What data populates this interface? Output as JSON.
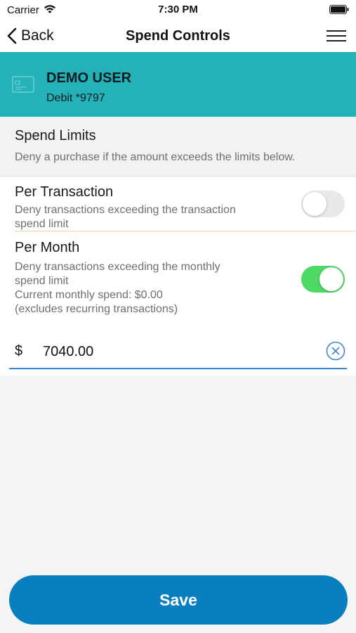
{
  "status_bar": {
    "carrier": "Carrier",
    "time": "7:30 PM"
  },
  "nav": {
    "back_label": "Back",
    "title": "Spend Controls"
  },
  "card": {
    "name": "DEMO USER",
    "number": "Debit *9797",
    "banner_color": "#24b1b7"
  },
  "spend_limits": {
    "title": "Spend Limits",
    "description": "Deny a purchase if the amount exceeds the limits below."
  },
  "per_transaction": {
    "title": "Per Transaction",
    "desc_line1": "Deny transactions exceeding the transaction",
    "desc_line2": "spend limit",
    "enabled": false
  },
  "per_month": {
    "title": "Per Month",
    "desc_line1": "Deny transactions exceeding the monthly",
    "desc_line2": "spend limit",
    "desc_line3": "Current monthly spend: $0.00",
    "desc_line4": "(excludes recurring transactions)",
    "enabled": true,
    "currency": "$",
    "amount": "7040.00"
  },
  "save_label": "Save",
  "colors": {
    "toggle_on": "#4cd964",
    "accent": "#0a7fc0",
    "input_underline": "#3a86d1"
  },
  "icons": [
    "wifi-icon",
    "battery-icon",
    "back-chevron-icon",
    "menu-icon",
    "card-icon",
    "clear-icon"
  ]
}
